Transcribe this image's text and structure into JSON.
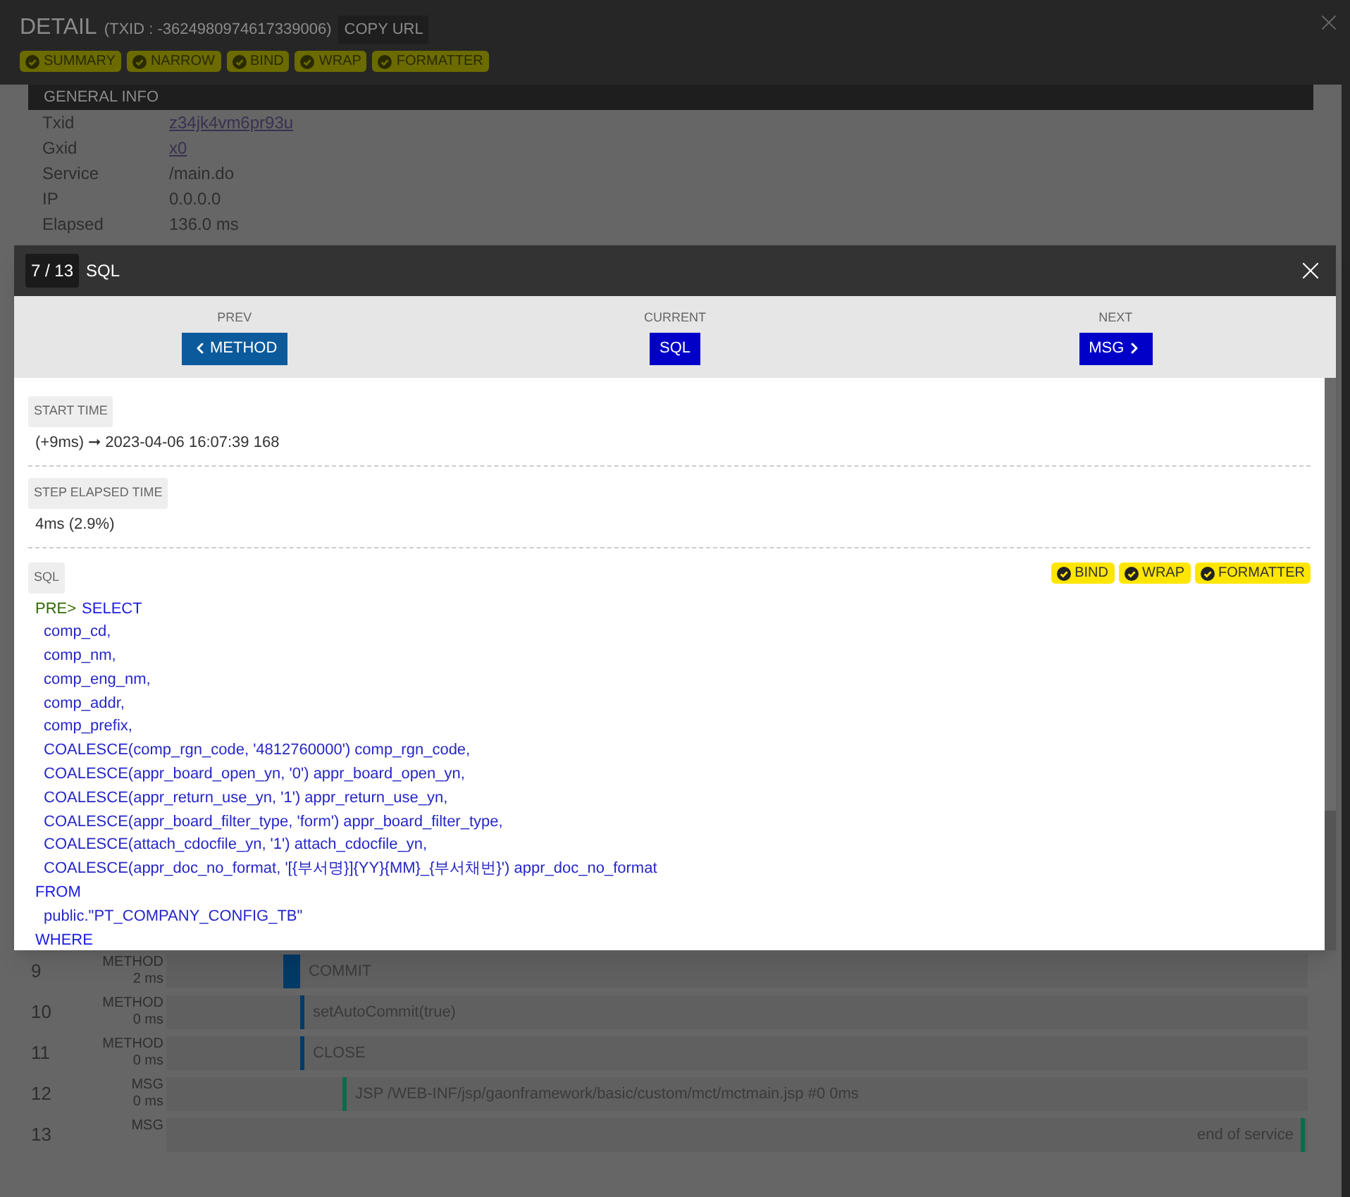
{
  "header": {
    "title": "DETAIL",
    "txid": "(TXID : -3624980974617339006)",
    "copy_button": "COPY URL",
    "toggles": [
      {
        "label": "SUMMARY",
        "checked": true
      },
      {
        "label": "NARROW",
        "checked": true
      },
      {
        "label": "BIND",
        "checked": true
      },
      {
        "label": "WRAP",
        "checked": true
      },
      {
        "label": "FORMATTER",
        "checked": true
      }
    ]
  },
  "general_info": {
    "title": "GENERAL INFO",
    "rows": [
      {
        "label": "Txid",
        "value": "z34jk4vm6pr93u",
        "kind": "link"
      },
      {
        "label": "Gxid",
        "value": "x0",
        "kind": "link"
      },
      {
        "label": "Service",
        "value": "/main.do",
        "kind": "text"
      },
      {
        "label": "IP",
        "value": "0.0.0.0",
        "kind": "text"
      },
      {
        "label": "Elapsed",
        "value": "136.0 ms",
        "kind": "text"
      }
    ]
  },
  "timeline": [
    {
      "number": "9",
      "type": "METHOD",
      "duration": "2 ms",
      "text": "COMMIT",
      "color": "#003a66"
    },
    {
      "number": "10",
      "type": "METHOD",
      "duration": "0 ms",
      "text": "setAutoCommit(true)",
      "color": "#003a66"
    },
    {
      "number": "11",
      "type": "METHOD",
      "duration": "0 ms",
      "text": "CLOSE",
      "color": "#003a66"
    },
    {
      "number": "12",
      "type": "MSG",
      "duration": "0 ms",
      "text": "JSP /WEB-INF/jsp/gaonframework/basic/custom/mct/mctmain.jsp #0 0ms",
      "color": "#0c6b4a"
    },
    {
      "number": "13",
      "type": "MSG",
      "text": "end of service",
      "color": "#0c6b4a"
    }
  ],
  "modal": {
    "counter": "7 / 13",
    "title": "SQL",
    "nav": [
      {
        "label": "PREV",
        "button": "METHOD",
        "kind": "prev"
      },
      {
        "label": "CURRENT",
        "button": "SQL",
        "kind": "current"
      },
      {
        "label": "NEXT",
        "button": "MSG",
        "kind": "next"
      }
    ],
    "start_time": {
      "label": "START TIME",
      "value": "(+9ms) ➞ 2023-04-06 16:07:39 168"
    },
    "step_elapsed": {
      "label": "STEP ELAPSED TIME",
      "value": "4ms (2.9%)"
    },
    "sql": {
      "label": "SQL",
      "toggles": [
        {
          "label": "BIND",
          "checked": true
        },
        {
          "label": "WRAP",
          "checked": true
        },
        {
          "label": "FORMATTER",
          "checked": true
        }
      ],
      "prefix": "PRE>",
      "lines": [
        {
          "text": "SELECT",
          "kind": "keyword"
        },
        {
          "text": "comp_cd,",
          "kind": "item"
        },
        {
          "text": "comp_nm,",
          "kind": "item"
        },
        {
          "text": "comp_eng_nm,",
          "kind": "item"
        },
        {
          "text": "comp_addr,",
          "kind": "item"
        },
        {
          "text": "comp_prefix,",
          "kind": "item"
        },
        {
          "text": "COALESCE(comp_rgn_code, '4812760000') comp_rgn_code,",
          "kind": "item"
        },
        {
          "text": "COALESCE(appr_board_open_yn, '0') appr_board_open_yn,",
          "kind": "item"
        },
        {
          "text": "COALESCE(appr_return_use_yn, '1') appr_return_use_yn,",
          "kind": "item"
        },
        {
          "text": "COALESCE(appr_board_filter_type, 'form') appr_board_filter_type,",
          "kind": "item"
        },
        {
          "text": "COALESCE(attach_cdocfile_yn, '1') attach_cdocfile_yn,",
          "kind": "item"
        },
        {
          "text": "COALESCE(appr_doc_no_format, '[{부서명}]{YY}{MM}_{부서채번}') appr_doc_no_format",
          "kind": "item"
        },
        {
          "text": "FROM",
          "kind": "keyword"
        },
        {
          "text": "public.\"PT_COMPANY_CONFIG_TB\"",
          "kind": "item"
        },
        {
          "text": "WHERE",
          "kind": "keyword"
        }
      ]
    }
  }
}
